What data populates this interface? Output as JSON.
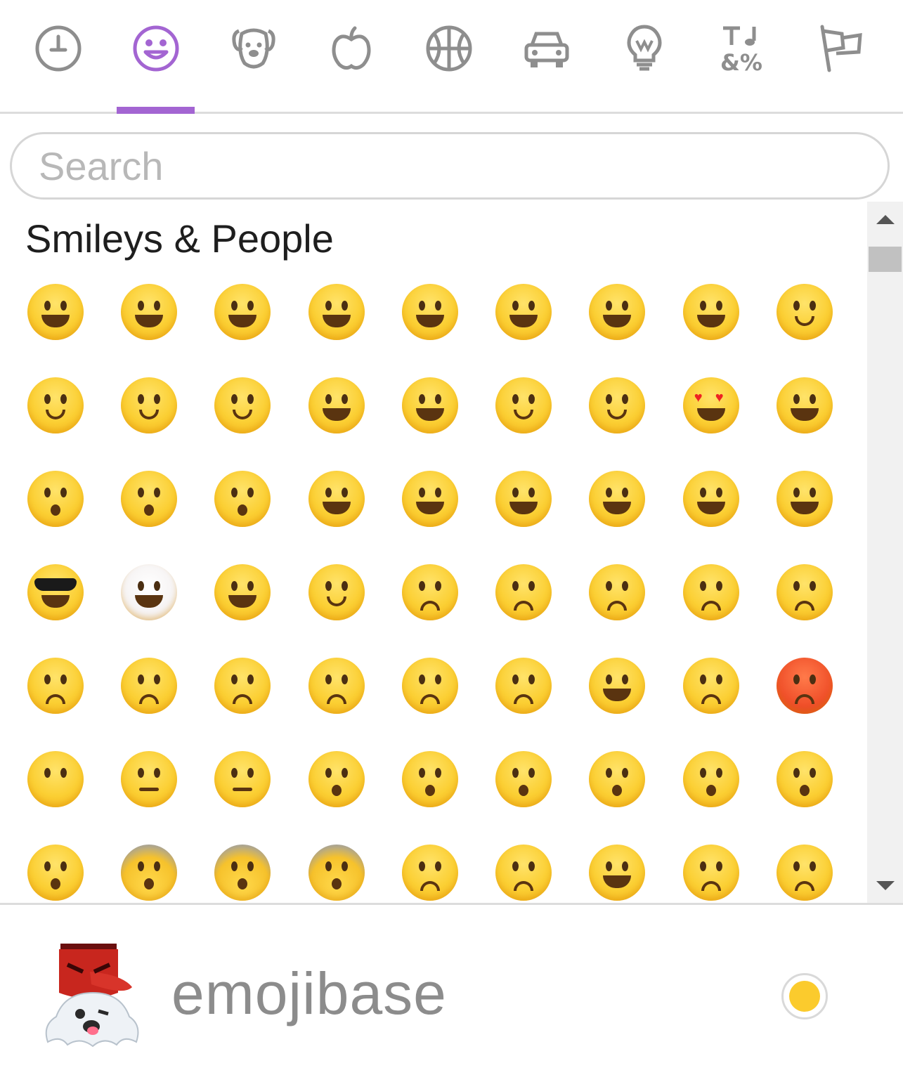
{
  "accent_color": "#a365d2",
  "tabs": [
    {
      "name": "recent",
      "icon": "clock-icon"
    },
    {
      "name": "smileys",
      "icon": "smiley-icon",
      "active": true
    },
    {
      "name": "animals",
      "icon": "dog-icon"
    },
    {
      "name": "food",
      "icon": "apple-icon"
    },
    {
      "name": "activity",
      "icon": "basketball-icon"
    },
    {
      "name": "travel",
      "icon": "car-icon"
    },
    {
      "name": "objects",
      "icon": "lightbulb-icon"
    },
    {
      "name": "symbols",
      "icon": "symbols-icon"
    },
    {
      "name": "flags",
      "icon": "flag-icon"
    }
  ],
  "search": {
    "placeholder": "Search",
    "value": ""
  },
  "category": {
    "title": "Smileys & People"
  },
  "emoji_rows": [
    [
      "grinning",
      "smiley",
      "smile",
      "grin",
      "laughing",
      "sweat-smile",
      "joy",
      "rofl",
      "relaxed"
    ],
    [
      "blush",
      "innocent",
      "slightly-smiling",
      "upside-down",
      "wink",
      "relieved",
      "relieved-2",
      "heart-eyes",
      "kissing-heart"
    ],
    [
      "kissing",
      "kissing-smiling",
      "kissing-closed",
      "yum",
      "stuck-out-wink",
      "stuck-out-closed",
      "stuck-out",
      "money-mouth",
      "hugging"
    ],
    [
      "sunglasses",
      "clown",
      "cowboy",
      "smirk",
      "unamused",
      "disappointed",
      "pensive",
      "worried",
      "confused"
    ],
    [
      "slightly-frowning",
      "frowning",
      "persevere",
      "confounded",
      "tired",
      "weary",
      "triumph",
      "angry",
      "rage"
    ],
    [
      "no-mouth",
      "neutral",
      "expressionless",
      "hushed",
      "frowning-open",
      "anguished",
      "open-mouth",
      "astonished",
      "dizzy"
    ],
    [
      "flushed",
      "scream",
      "fearful",
      "cold-sweat",
      "cry",
      "disappointed-relieved",
      "drool",
      "sob",
      "sweat"
    ]
  ],
  "footer": {
    "brand": "emojibase",
    "preview_icon": "goblin-ghost-icon",
    "skin_tone_color": "#fbcb2d"
  }
}
